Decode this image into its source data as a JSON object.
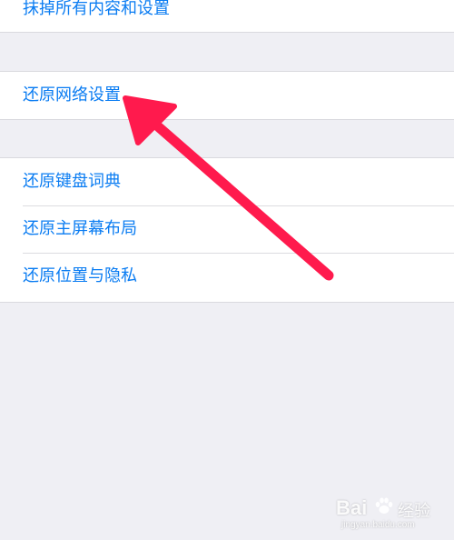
{
  "settings": {
    "erase_all": "抹掉所有内容和设置",
    "reset_network": "还原网络设置",
    "reset_keyboard": "还原键盘词典",
    "reset_home_screen": "还原主屏幕布局",
    "reset_location_privacy": "还原位置与隐私"
  },
  "watermark": {
    "brand": "Bai",
    "jingyan": "经验",
    "url": "jingyan.baidu.com"
  },
  "colors": {
    "link_blue": "#0a7cf2",
    "background": "#efeff4",
    "arrow": "#ff1a4d"
  },
  "annotation": {
    "icon": "arrow-pointer-icon"
  }
}
